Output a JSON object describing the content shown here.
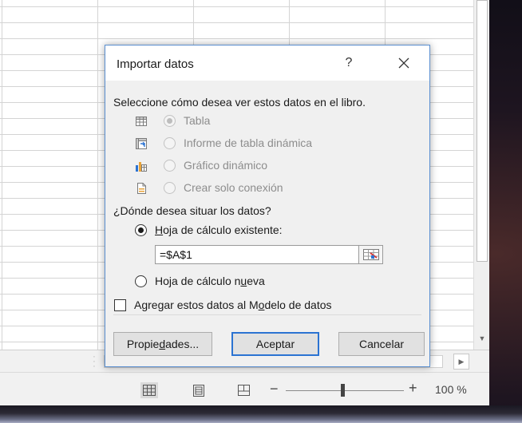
{
  "dialog": {
    "title": "Importar datos",
    "help_label": "?",
    "prompt": "Seleccione cómo desea ver estos datos en el libro.",
    "view_options": [
      {
        "label": "Tabla",
        "icon": "table-icon",
        "selected": true,
        "enabled": false
      },
      {
        "label": "Informe de tabla dinámica",
        "icon": "pivot-table-icon",
        "selected": false,
        "enabled": false
      },
      {
        "label": "Gráfico dinámico",
        "icon": "pivot-chart-icon",
        "selected": false,
        "enabled": false
      },
      {
        "label": "Crear solo conexión",
        "icon": "connection-icon",
        "selected": false,
        "enabled": false
      }
    ],
    "location_prompt": "¿Dónde desea situar los datos?",
    "existing_sheet": {
      "prefix": "",
      "access": "H",
      "rest": "oja de cálculo existente:",
      "selected": true
    },
    "range_value": "=$A$1",
    "new_sheet": {
      "prefix": "Hoja de cálculo n",
      "access": "u",
      "rest": "eva",
      "selected": false
    },
    "data_model": {
      "prefix": "Agregar estos datos al M",
      "access": "o",
      "rest": "delo de datos",
      "checked": false
    },
    "buttons": {
      "properties": {
        "prefix": "Propie",
        "access": "d",
        "rest": "ades..."
      },
      "accept": "Aceptar",
      "cancel": "Cancelar"
    }
  },
  "statusbar": {
    "zoom_minus": "−",
    "zoom_plus": "+",
    "zoom_level": "100 %",
    "zoom_value_percent": 100
  },
  "colors": {
    "accent": "#2b73d2",
    "dialog_border": "#5a8fd0",
    "dialog_bg": "#f0f0f0"
  }
}
